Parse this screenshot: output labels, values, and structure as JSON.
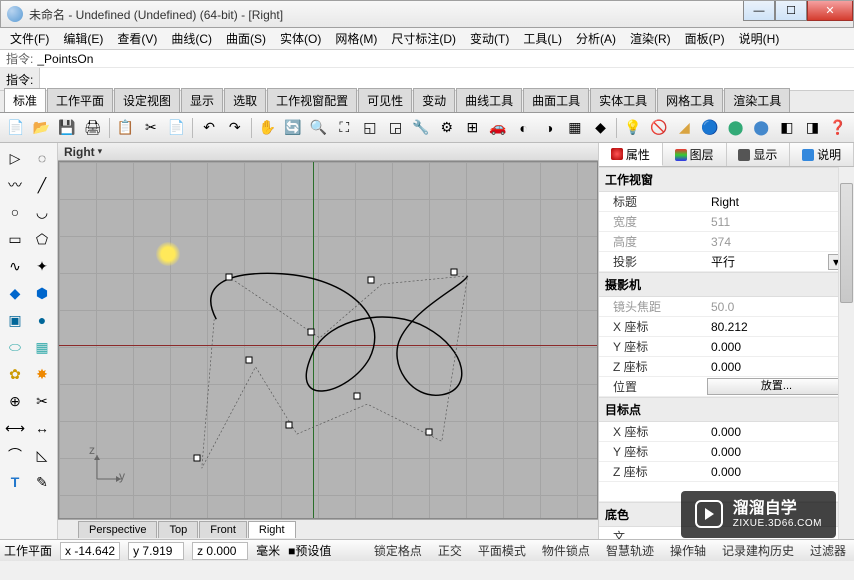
{
  "window": {
    "title": "未命名 - Undefined (Undefined) (64-bit) - [Right]"
  },
  "menu": [
    "文件(F)",
    "编辑(E)",
    "查看(V)",
    "曲线(C)",
    "曲面(S)",
    "实体(O)",
    "网格(M)",
    "尺寸标注(D)",
    "变动(T)",
    "工具(L)",
    "分析(A)",
    "渲染(R)",
    "面板(P)",
    "说明(H)"
  ],
  "cmd": {
    "label1": "指令:",
    "value1": "_PointsOn",
    "label2": "指令:"
  },
  "tabs": [
    "标准",
    "工作平面",
    "设定视图",
    "显示",
    "选取",
    "工作视窗配置",
    "可见性",
    "变动",
    "曲线工具",
    "曲面工具",
    "实体工具",
    "网格工具",
    "渲染工具"
  ],
  "viewport": {
    "label": "Right",
    "axis_z": "z",
    "axis_y": "y"
  },
  "vptabs": [
    "Perspective",
    "Top",
    "Front",
    "Right"
  ],
  "rpanel": {
    "tabs": {
      "props": "属性",
      "layers": "图层",
      "display": "显示",
      "help": "说明"
    },
    "sections": {
      "viewport": "工作视窗",
      "camera": "摄影机",
      "target": "目标点",
      "bottom": "底色"
    },
    "rows": {
      "title_k": "标题",
      "title_v": "Right",
      "width_k": "宽度",
      "width_v": "511",
      "height_k": "高度",
      "height_v": "374",
      "proj_k": "投影",
      "proj_v": "平行",
      "focal_k": "镜头焦距",
      "focal_v": "50.0",
      "xk": "X 座标",
      "xv1": "80.212",
      "yk": "Y 座标",
      "yv1": "0.000",
      "zk": "Z 座标",
      "zv1": "0.000",
      "pos_k": "位置",
      "pos_btn": "放置...",
      "xv2": "0.000",
      "yv2": "0.000",
      "zv2": "0.000",
      "txt_k": "文"
    }
  },
  "status": {
    "plane": "工作平面",
    "x": "x -14.642",
    "y": "y 7.919",
    "z": "z 0.000",
    "unit": "毫米",
    "preset": "■预设值",
    "items": [
      "锁定格点",
      "正交",
      "平面模式",
      "物件锁点",
      "智慧轨迹",
      "操作轴",
      "记录建构历史",
      "过滤器"
    ]
  },
  "watermark": {
    "cn": "溜溜自学",
    "url": "ZIXUE.3D66.COM"
  }
}
